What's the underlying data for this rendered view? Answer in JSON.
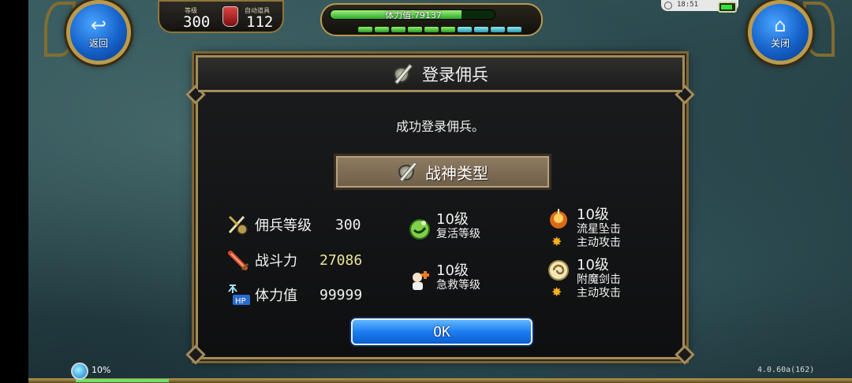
{
  "nav": {
    "back_label": "返回",
    "close_label": "关闭"
  },
  "hud": {
    "level_caption": "等级",
    "level_value": "300",
    "auto_item_caption": "自动道具",
    "auto_item_value": "112",
    "hp_text": "体力值:79137",
    "hp_fill_fraction": 0.8,
    "energy_segments": 10,
    "time": "18:51"
  },
  "dialog": {
    "title": "登录佣兵",
    "message": "成功登录佣兵。",
    "type_label": "战神类型",
    "stats": [
      {
        "label": "佣兵等级",
        "value": "300",
        "icon": "sword-shield-icon"
      },
      {
        "label": "战斗力",
        "value": "27086",
        "icon": "sword-icon"
      },
      {
        "label": "体力值",
        "value": "99999",
        "icon": "hp-icon"
      }
    ],
    "skills_mid": [
      {
        "level": "10级",
        "name": "复活等级",
        "icon": "revive-icon"
      },
      {
        "level": "10级",
        "name": "急救等级",
        "icon": "first-aid-icon"
      }
    ],
    "skills_right": [
      {
        "level": "10级",
        "name": "流星坠击",
        "kind": "主动攻击",
        "icon": "meteor-icon"
      },
      {
        "level": "10级",
        "name": "附魔剑击",
        "kind": "主动攻击",
        "icon": "enchant-sword-icon"
      }
    ],
    "ok_label": "OK"
  },
  "footer": {
    "progress_text": "10%",
    "version": "4.0.60a(162)"
  },
  "colors": {
    "gold_border": "#a48c59",
    "ok_blue": "#1d7df0",
    "power_value": "#ede59a"
  }
}
